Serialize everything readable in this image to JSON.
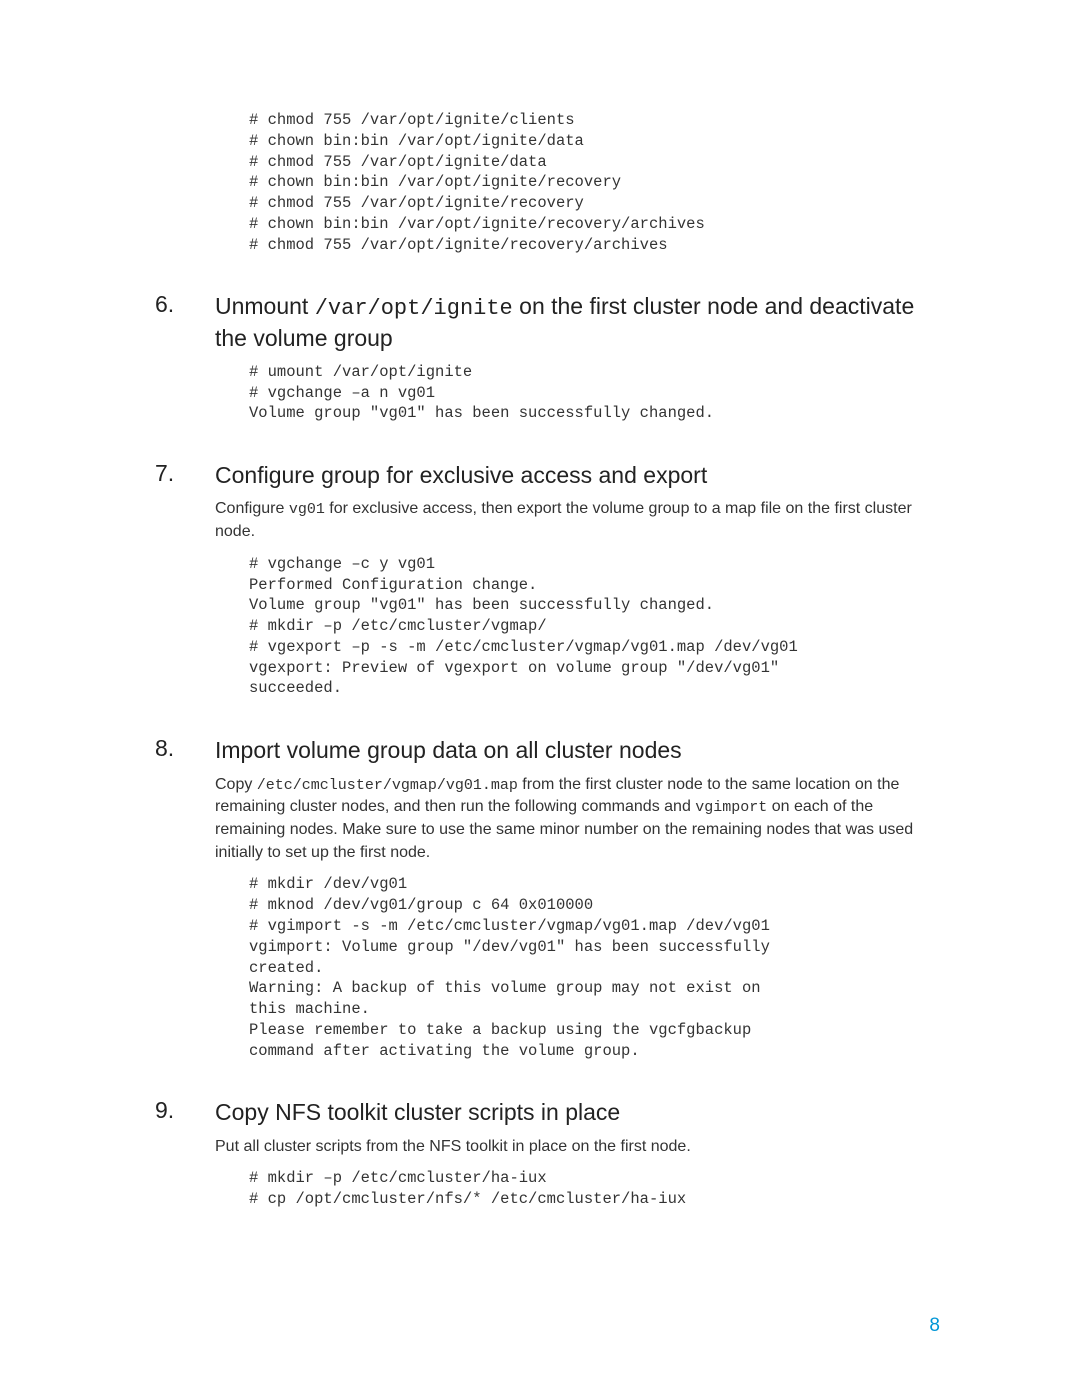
{
  "code_top": "# chmod 755 /var/opt/ignite/clients\n# chown bin:bin /var/opt/ignite/data\n# chmod 755 /var/opt/ignite/data\n# chown bin:bin /var/opt/ignite/recovery\n# chmod 755 /var/opt/ignite/recovery\n# chown bin:bin /var/opt/ignite/recovery/archives\n# chmod 755 /var/opt/ignite/recovery/archives",
  "s6": {
    "num": "6.",
    "h_pre": "Unmount ",
    "h_mono": "/var/opt/ignite",
    "h_post": " on the first cluster node and deactivate the volume group",
    "code": "# umount /var/opt/ignite\n# vgchange –a n vg01\nVolume group \"vg01\" has been successfully changed."
  },
  "s7": {
    "num": "7.",
    "h": "Configure group for exclusive access and export",
    "p_pre": "Configure ",
    "p_mono": "vg01",
    "p_post": " for exclusive access, then export the volume group to a map file on the first cluster node.",
    "code": "# vgchange –c y vg01\nPerformed Configuration change.\nVolume group \"vg01\" has been successfully changed.\n# mkdir –p /etc/cmcluster/vgmap/\n# vgexport –p -s -m /etc/cmcluster/vgmap/vg01.map /dev/vg01\nvgexport: Preview of vgexport on volume group \"/dev/vg01\"\nsucceeded."
  },
  "s8": {
    "num": "8.",
    "h": "Import volume group data on all cluster nodes",
    "p_a1": "Copy ",
    "p_mono1": "/etc/cmcluster/vgmap/vg01.map",
    "p_a2": " from the first cluster node to the same location on the remaining cluster nodes, and then run the following commands and ",
    "p_mono2": "vgimport",
    "p_a3": " on each of the remaining nodes. Make sure to use the same minor number on the remaining nodes that was used initially to set up the first node.",
    "code": "# mkdir /dev/vg01\n# mknod /dev/vg01/group c 64 0x010000\n# vgimport -s -m /etc/cmcluster/vgmap/vg01.map /dev/vg01\nvgimport: Volume group \"/dev/vg01\" has been successfully\ncreated.\nWarning: A backup of this volume group may not exist on\nthis machine.\nPlease remember to take a backup using the vgcfgbackup\ncommand after activating the volume group."
  },
  "s9": {
    "num": "9.",
    "h": "Copy NFS toolkit cluster scripts in place",
    "p": "Put all cluster scripts from the NFS toolkit in place on the first node.",
    "code": "# mkdir –p /etc/cmcluster/ha-iux\n# cp /opt/cmcluster/nfs/* /etc/cmcluster/ha-iux"
  },
  "page_number": "8"
}
